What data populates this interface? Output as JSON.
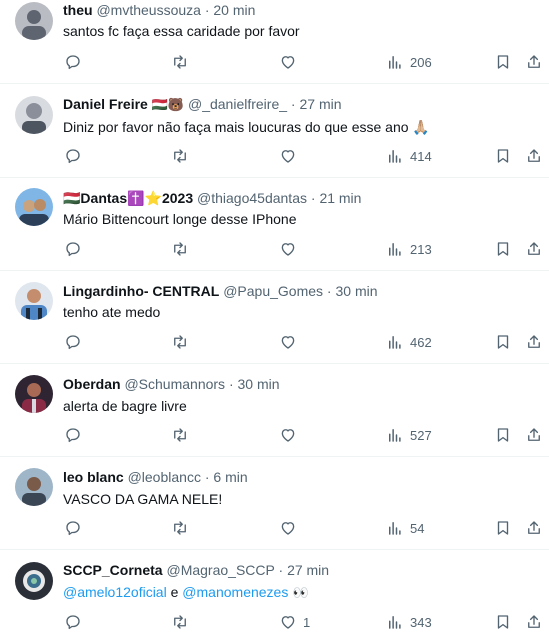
{
  "tweets": [
    {
      "name": "theu",
      "badges": "",
      "handle": "@mvtheussouza",
      "sep": "·",
      "time": "20 min",
      "text": "santos fc faça essa caridade por favor",
      "likes": "",
      "views": "206",
      "avatar_colors": [
        "#b9bcc2",
        "#5e6470"
      ]
    },
    {
      "name": "Daniel Freire",
      "badges": "🇭🇺🐻",
      "handle": "@_danielfreire_",
      "sep": "·",
      "time": "27 min",
      "text": "Diniz por favor não faça mais loucuras do que esse ano 🙏🏼",
      "likes": "",
      "views": "414",
      "avatar_colors": [
        "#d8dbe0",
        "#8a8f99"
      ]
    },
    {
      "name": "🇭🇺Dantas✝️⭐2023",
      "badges": "",
      "handle": "@thiago45dantas",
      "sep": "·",
      "time": "21 min",
      "text": "Mário Bittencourt longe desse IPhone",
      "likes": "",
      "views": "213",
      "avatar_colors": [
        "#7fb6e6",
        "#2b3f59"
      ]
    },
    {
      "name": "Lingardinho- CENTRAL",
      "badges": "",
      "handle": "@Papu_Gomes",
      "sep": "·",
      "time": "30 min",
      "text": "tenho ate medo",
      "likes": "",
      "views": "462",
      "avatar_colors": [
        "#4f87c6",
        "#1d2a3a"
      ]
    },
    {
      "name": "Oberdan",
      "badges": "",
      "handle": "@Schumannors",
      "sep": "·",
      "time": "30 min",
      "text": "alerta de bagre livre",
      "likes": "",
      "views": "527",
      "avatar_colors": [
        "#8a2a45",
        "#2e2432"
      ]
    },
    {
      "name": "leo blanc",
      "badges": "",
      "handle": "@leoblancc",
      "sep": "·",
      "time": "6 min",
      "text": "VASCO DA GAMA NELE!",
      "likes": "",
      "views": "54",
      "avatar_colors": [
        "#9fb6c9",
        "#3b4654"
      ]
    },
    {
      "name": "SCCP_Corneta",
      "badges": "",
      "handle": "@Magrao_SCCP",
      "sep": "·",
      "time": "27 min",
      "text_parts": [
        "@amelo12oficial",
        " e ",
        "@manomenezes",
        " 👀"
      ],
      "likes": "1",
      "views": "343",
      "avatar_colors": [
        "#2a2f38",
        "#8ac6a8"
      ]
    }
  ],
  "icons": {
    "reply": "reply-icon",
    "retweet": "retweet-icon",
    "like": "like-icon",
    "views": "views-icon",
    "bookmark": "bookmark-icon",
    "share": "share-icon"
  },
  "colors": {
    "text": "#0f1419",
    "secondary": "#536471",
    "link": "#1d9bf0",
    "divider": "#eff3f4"
  }
}
